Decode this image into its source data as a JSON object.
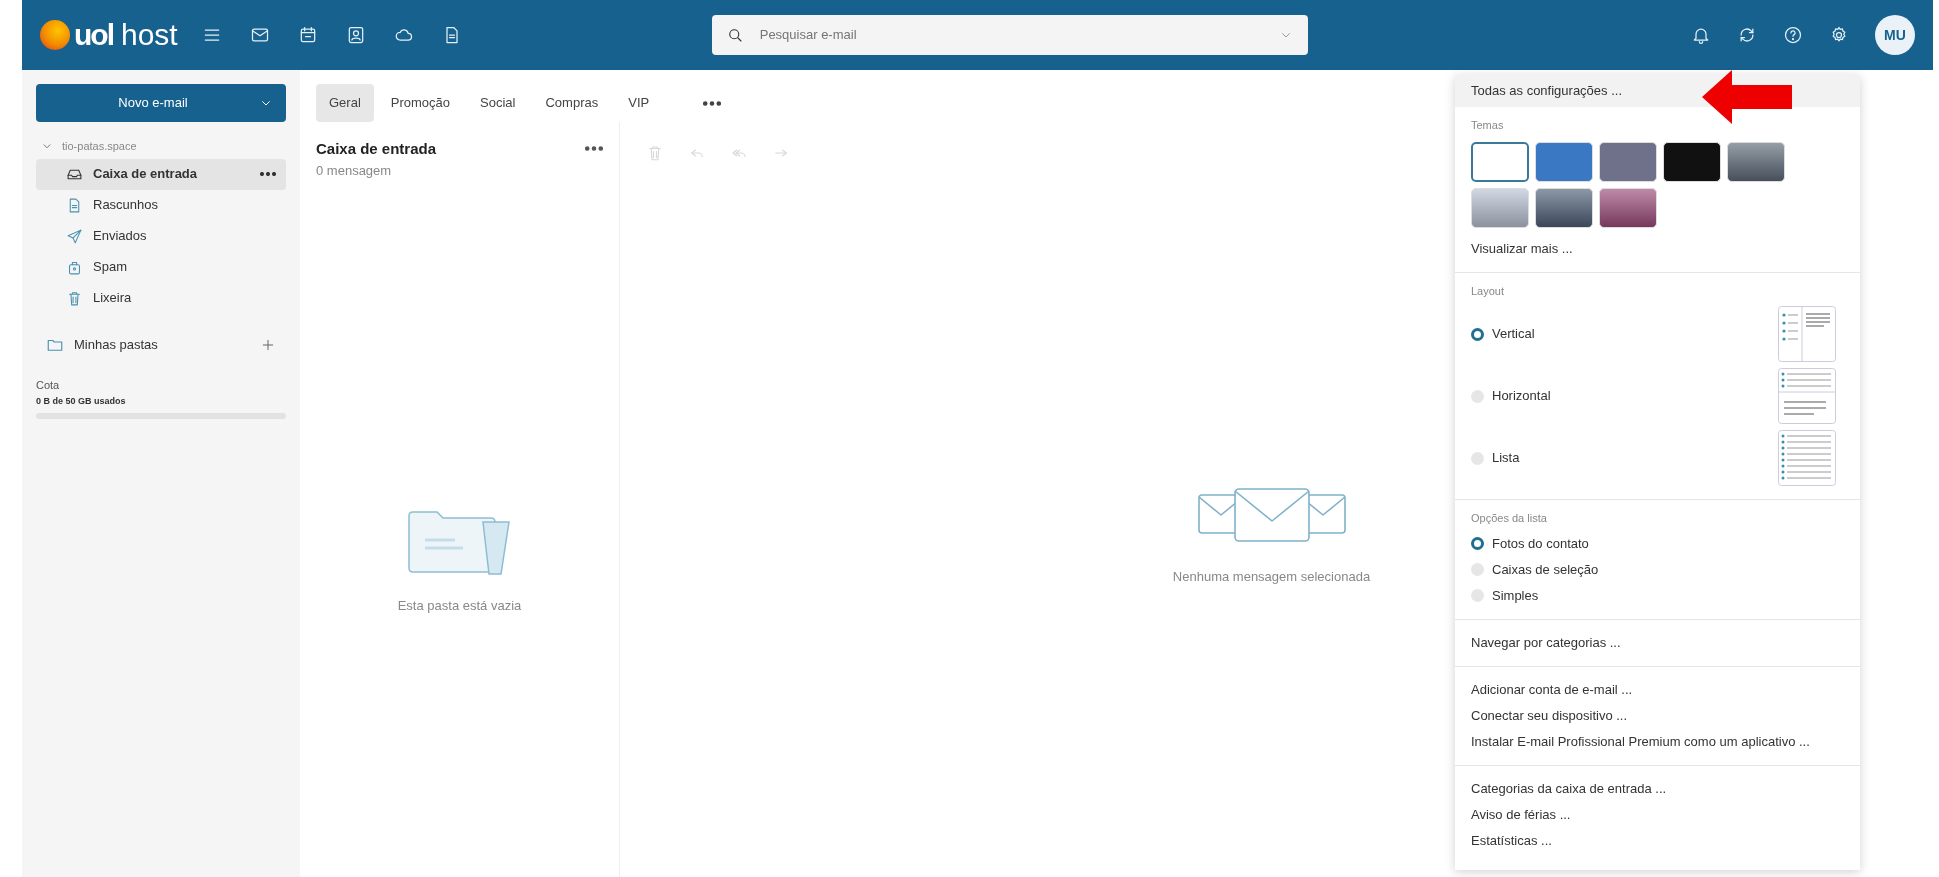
{
  "topbar": {
    "logo": {
      "brand": "uol",
      "product": "host"
    },
    "apps": [
      {
        "kind": "menu"
      },
      {
        "kind": "mail"
      },
      {
        "kind": "calendar"
      },
      {
        "kind": "contacts"
      },
      {
        "kind": "cloud"
      },
      {
        "kind": "document"
      }
    ],
    "search": {
      "placeholder": "Pesquisar e-mail"
    },
    "actions": [
      {
        "kind": "bell"
      },
      {
        "kind": "sync"
      },
      {
        "kind": "help"
      },
      {
        "kind": "settings"
      }
    ],
    "avatar": "MU"
  },
  "sidebar": {
    "new_button": "Novo e-mail",
    "account": "tio-patas.space",
    "folders": [
      {
        "kind": "inbox",
        "label": "Caixa de entrada",
        "selected": true
      },
      {
        "kind": "drafts",
        "label": "Rascunhos",
        "selected": false
      },
      {
        "kind": "sent",
        "label": "Enviados",
        "selected": false
      },
      {
        "kind": "spam",
        "label": "Spam",
        "selected": false
      },
      {
        "kind": "trash",
        "label": "Lixeira",
        "selected": false
      }
    ],
    "my_folders": "Minhas pastas",
    "quota": {
      "label": "Cota",
      "usage": "0 B de 50 GB usados",
      "level": 0
    }
  },
  "tabs": [
    {
      "label": "Geral",
      "selected": true
    },
    {
      "label": "Promoção",
      "selected": false
    },
    {
      "label": "Social",
      "selected": false
    },
    {
      "label": "Compras",
      "selected": false
    },
    {
      "label": "VIP",
      "selected": false
    }
  ],
  "message_list": {
    "title": "Caixa de entrada",
    "count": "0 mensagem",
    "empty_text": "Esta pasta está vazia"
  },
  "reading_pane": {
    "toolbar": [
      {
        "kind": "trash",
        "disabled": true
      },
      {
        "kind": "reply",
        "disabled": true
      },
      {
        "kind": "reply_all",
        "disabled": true
      },
      {
        "kind": "forward",
        "disabled": true
      }
    ],
    "empty_text": "Nenhuma mensagem selecionada"
  },
  "settings_menu": {
    "all_settings": {
      "label": "Todas as configurações ...",
      "highlighted": true
    },
    "themes_label": "Temas",
    "themes": [
      {
        "kind": "solid",
        "color": "#ffffff",
        "selected": true
      },
      {
        "kind": "solid",
        "color": "#3b78c4",
        "selected": false
      },
      {
        "kind": "solid",
        "color": "#6e7189",
        "selected": false
      },
      {
        "kind": "solid",
        "color": "#111111",
        "selected": false
      },
      {
        "kind": "photo",
        "color": "#5d6a78",
        "selected": false
      },
      {
        "kind": "photo",
        "color": "#b9c3d3",
        "selected": false
      },
      {
        "kind": "photo",
        "color": "#4f5f77",
        "selected": false
      },
      {
        "kind": "photo",
        "color": "#9c4c7a",
        "selected": false
      }
    ],
    "more_themes": "Visualizar mais ...",
    "layout_label": "Layout",
    "layouts": [
      {
        "kind": "vertical",
        "label": "Vertical",
        "selected": true
      },
      {
        "kind": "horizontal",
        "label": "Horizontal",
        "selected": false
      },
      {
        "kind": "list",
        "label": "Lista",
        "selected": false
      }
    ],
    "list_options_label": "Opções da lista",
    "list_options": [
      {
        "label": "Fotos do contato",
        "selected": true
      },
      {
        "label": "Caixas de seleção",
        "selected": false
      },
      {
        "label": "Simples",
        "selected": false
      }
    ],
    "groups": [
      [
        "Navegar por categorias ..."
      ],
      [
        "Adicionar conta de e-mail ...",
        "Conectar seu dispositivo ...",
        "Instalar E-mail Profissional Premium como um aplicativo ..."
      ],
      [
        "Categorias da caixa de entrada ...",
        "Aviso de férias ...",
        "Estatísticas ..."
      ]
    ]
  }
}
